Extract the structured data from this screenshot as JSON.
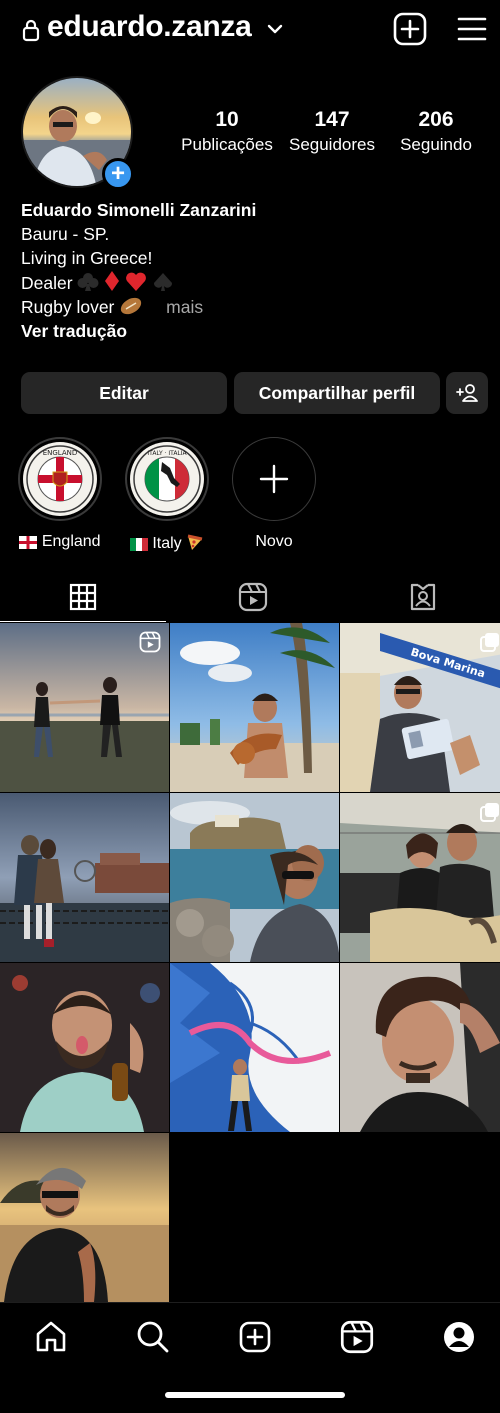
{
  "header": {
    "username": "eduardo.zanza"
  },
  "profile": {
    "stats": [
      {
        "value": "10",
        "label": "Publicações"
      },
      {
        "value": "147",
        "label": "Seguidores"
      },
      {
        "value": "206",
        "label": "Seguindo"
      }
    ],
    "bio": {
      "name": "Eduardo Simonelli Zanzarini",
      "line1": "Bauru - SP.",
      "line2": "Living in Greece!",
      "line3": "Dealer",
      "line4": "Rugby lover",
      "more": "mais",
      "translate": "Ver tradução"
    }
  },
  "actions": {
    "edit": "Editar",
    "share": "Compartilhar perfil"
  },
  "highlights": [
    {
      "label": "England",
      "badge_text": "ENGLAND"
    },
    {
      "label": "Italy",
      "badge_text": "ITALY · ITALIA"
    },
    {
      "label": "Novo"
    }
  ],
  "colors": {
    "accent_blue": "#3897f0",
    "button_bg": "#262626",
    "secondary_text": "#a8a8a8",
    "background": "#000000"
  },
  "icons": {
    "header": [
      "lock-icon",
      "chevron-down-icon",
      "create-post-icon",
      "menu-icon"
    ],
    "tabs": [
      "grid-icon",
      "reels-icon",
      "tagged-icon"
    ],
    "nav": [
      "home-icon",
      "search-icon",
      "create-icon",
      "reels-icon",
      "profile-icon"
    ]
  }
}
